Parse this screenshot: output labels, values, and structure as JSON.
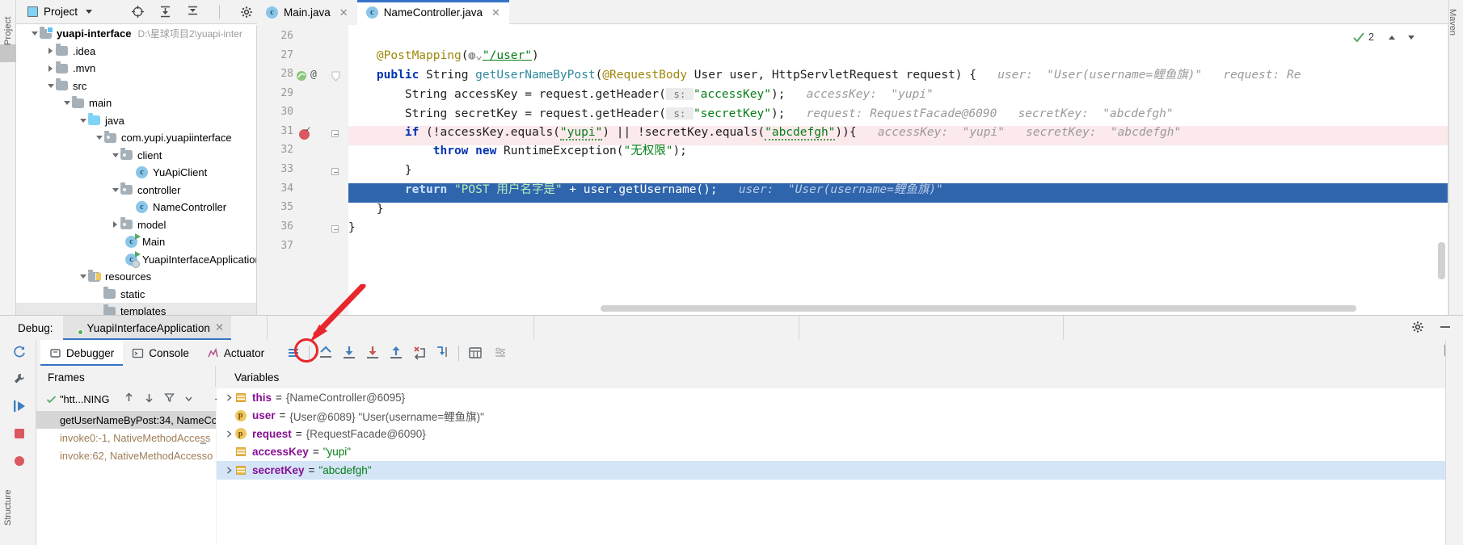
{
  "window": {
    "left_strip_label": "Project",
    "right_strip_label": "Maven",
    "bottom_left_label": "Structure"
  },
  "toolbar": {
    "project_button": "Project",
    "icons": [
      "locate-icon",
      "expand-all-icon",
      "collapse-all-icon",
      "settings-gear-icon",
      "hide-icon"
    ]
  },
  "editor_tabs": [
    {
      "label": "Main.java",
      "icon": "java-class-run-icon",
      "active": false,
      "closable": true
    },
    {
      "label": "NameController.java",
      "icon": "java-class-icon",
      "active": true,
      "closable": true
    }
  ],
  "project_tree": [
    {
      "label": "yuapi-interface",
      "path": "D:\\星球项目2\\yuapi-inter",
      "indent": 0,
      "twisty": "down",
      "icon": "module-folder-icon",
      "bold": true
    },
    {
      "label": ".idea",
      "path": "",
      "indent": 1,
      "twisty": "right",
      "icon": "folder-icon",
      "bold": false
    },
    {
      "label": ".mvn",
      "path": "",
      "indent": 1,
      "twisty": "right",
      "icon": "folder-icon",
      "bold": false
    },
    {
      "label": "src",
      "path": "",
      "indent": 1,
      "twisty": "down",
      "icon": "folder-icon",
      "bold": false
    },
    {
      "label": "main",
      "path": "",
      "indent": 2,
      "twisty": "down",
      "icon": "folder-icon",
      "bold": false
    },
    {
      "label": "java",
      "path": "",
      "indent": 3,
      "twisty": "down",
      "icon": "source-folder-icon",
      "bold": false
    },
    {
      "label": "com.yupi.yuapiinterface",
      "path": "",
      "indent": 4,
      "twisty": "down",
      "icon": "package-icon",
      "bold": false
    },
    {
      "label": "client",
      "path": "",
      "indent": 5,
      "twisty": "down",
      "icon": "package-icon",
      "bold": false
    },
    {
      "label": "YuApiClient",
      "path": "",
      "indent": 6,
      "twisty": "none",
      "icon": "java-class-icon",
      "bold": false
    },
    {
      "label": "controller",
      "path": "",
      "indent": 5,
      "twisty": "down",
      "icon": "package-icon",
      "bold": false
    },
    {
      "label": "NameController",
      "path": "",
      "indent": 6,
      "twisty": "none",
      "icon": "java-class-icon",
      "bold": false
    },
    {
      "label": "model",
      "path": "",
      "indent": 5,
      "twisty": "right",
      "icon": "package-icon",
      "bold": false
    },
    {
      "label": "Main",
      "path": "",
      "indent": 5,
      "twisty": "none",
      "icon": "java-class-run-icon",
      "bold": false
    },
    {
      "label": "YuapiInterfaceApplication",
      "path": "",
      "indent": 5,
      "twisty": "none",
      "icon": "spring-boot-class-icon",
      "bold": false
    },
    {
      "label": "resources",
      "path": "",
      "indent": 3,
      "twisty": "down",
      "icon": "resources-folder-icon",
      "bold": false
    },
    {
      "label": "static",
      "path": "",
      "indent": 4,
      "twisty": "none",
      "icon": "folder-icon",
      "bold": false
    },
    {
      "label": "templates",
      "path": "",
      "indent": 4,
      "twisty": "none",
      "icon": "folder-icon",
      "bold": false
    }
  ],
  "code": {
    "first_line_number": 26,
    "lines": [
      {
        "n": 26,
        "html": ""
      },
      {
        "n": 27,
        "html": "<span class='anno'>    @PostMapping</span><span class='plain'>(</span><span class='gicon'>&#9728;</span><span class='str'><span class='urlink'>\"/user\"</span></span><span class='plain'>)</span>"
      },
      {
        "n": 28,
        "html": "<span class='kw'>    public </span><span class='plain'>String </span><span class='meth'>getUserNameByPost</span><span class='plain'>(</span><span class='anno'>@RequestBody</span><span class='plain'> User user, HttpServletRequest request) {</span>"
      },
      {
        "n": 29,
        "html": "<span class='plain'>        String accessKey = request.getHeader(</span> <span class='pbadge'>s:</span> <span class='str'>\"accessKey\"</span><span class='plain'>);</span>"
      },
      {
        "n": 30,
        "html": "<span class='plain'>        String secretKey = request.getHeader(</span> <span class='pbadge'>s:</span> <span class='str'>\"secretKey\"</span><span class='plain'>);</span>"
      },
      {
        "n": 31,
        "html": "<span class='kw'>        if</span><span class='plain'> (!accessKey.equals(</span><span class='str wavy'>\"yupi\"</span><span class='plain'>) || !secretKey.equals(</span><span class='str wavy'>\"abcdefgh\"</span><span class='plain'>)){</span>"
      },
      {
        "n": 32,
        "html": "<span class='kw'>            throw new</span><span class='plain'> RuntimeException(</span><span class='str'>\"无权限\"</span><span class='plain'>);</span>"
      },
      {
        "n": 33,
        "html": "<span class='plain'>        }</span>"
      },
      {
        "n": 34,
        "html": "<span class='kw'>        return</span><span class='plain'> </span><span class='str'>\"POST 用户名字是\"</span><span class='plain'> + user.getUsername();</span>"
      },
      {
        "n": 35,
        "html": "<span class='plain'>    }</span>"
      },
      {
        "n": 36,
        "html": "<span class='plain'>}</span>"
      },
      {
        "n": 37,
        "html": ""
      }
    ],
    "inline_hints": {
      "line28_user": "user:  \"User(username=鲤鱼旗)\"",
      "line28_request": "request: Re",
      "line29": "accessKey:  \"yupi\"",
      "line30_request": "request: RequestFacade@6090",
      "line30_secret": "secretKey:  \"abcdefgh\"",
      "line31_access": "accessKey:  \"yupi\"",
      "line31_secret": "secretKey:  \"abcdefgh\"",
      "line34": "user:  \"User(username=鲤鱼旗)\""
    },
    "inspection_count": "2",
    "breakpoint_line": 31,
    "execution_line": 34
  },
  "debug": {
    "title": "Debug:",
    "config_name": "YuapiInterfaceApplication",
    "tabs": [
      {
        "label": "Debugger",
        "icon": "debugger-icon",
        "active": true
      },
      {
        "label": "Console",
        "icon": "console-icon",
        "active": false
      },
      {
        "label": "Actuator",
        "icon": "actuator-icon",
        "active": false
      }
    ],
    "step_buttons": [
      "show-execution-point-icon",
      "step-over-icon",
      "step-into-icon",
      "force-step-into-icon",
      "step-out-icon",
      "drop-frame-icon",
      "run-to-cursor-icon",
      "evaluate-expression-icon",
      "mute-breakpoints-icon"
    ],
    "frames": {
      "title": "Frames",
      "thread": "\"htt...NING",
      "items": [
        {
          "label": "getUserNameByPost:34, NameCo",
          "selected": true,
          "muted": false
        },
        {
          "label": "invoke0:-1, NativeMethodAccess",
          "selected": false,
          "muted": true
        },
        {
          "label": "invoke:62, NativeMethodAccesso",
          "selected": false,
          "muted": true
        }
      ],
      "toolbar_icons": [
        "up-arrow-icon",
        "down-arrow-icon",
        "filter-icon",
        "chevron-down-icon",
        "add-icon",
        "remove-icon"
      ]
    },
    "variables": {
      "title": "Variables",
      "rows": [
        {
          "expandable": true,
          "icon": "object-icon",
          "name": "this",
          "value": "{NameController@6095}",
          "value_kind": "plain",
          "selected": false
        },
        {
          "expandable": false,
          "icon": "param-icon",
          "name": "user",
          "value": "{User@6089} \"User(username=鲤鱼旗)\"",
          "value_kind": "plain",
          "selected": false
        },
        {
          "expandable": true,
          "icon": "param-icon",
          "name": "request",
          "value": "{RequestFacade@6090}",
          "value_kind": "plain",
          "selected": false
        },
        {
          "expandable": false,
          "icon": "object-icon",
          "name": "accessKey",
          "value": "\"yupi\"",
          "value_kind": "string",
          "selected": false
        },
        {
          "expandable": true,
          "icon": "object-icon",
          "name": "secretKey",
          "value": "\"abcdefgh\"",
          "value_kind": "string",
          "selected": true
        }
      ]
    }
  },
  "colors": {
    "accent": "#3573c7",
    "selection": "#2f65ad",
    "breakpoint": "#db5860",
    "annotation_red": "#e8272c",
    "keyword": "#0033b3",
    "string": "#067d17",
    "hint": "#9a9a9a"
  }
}
